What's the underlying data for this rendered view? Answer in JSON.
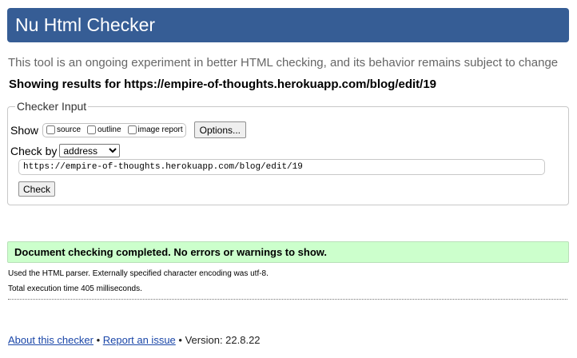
{
  "header": {
    "title": "Nu Html Checker"
  },
  "tagline": "This tool is an ongoing experiment in better HTML checking, and its behavior remains subject to change",
  "results_for": "Showing results for https://empire-of-thoughts.herokuapp.com/blog/edit/19",
  "checker_input": {
    "legend": "Checker Input",
    "show_label": "Show",
    "show_options": [
      {
        "label": "source",
        "checked": false
      },
      {
        "label": "outline",
        "checked": false
      },
      {
        "label": "image report",
        "checked": false
      }
    ],
    "options_button": "Options...",
    "check_by_label": "Check by",
    "check_by_selected": "address",
    "url_value": "https://empire-of-thoughts.herokuapp.com/blog/edit/19",
    "check_button": "Check"
  },
  "result": {
    "message": "Document checking completed. No errors or warnings to show.",
    "parser_info": "Used the HTML parser. Externally specified character encoding was utf-8.",
    "timing": "Total execution time 405 milliseconds."
  },
  "footer": {
    "about_link": "About this checker",
    "sep1": " • ",
    "report_link": "Report an issue",
    "sep2": " • ",
    "version": "Version: 22.8.22"
  },
  "colors": {
    "header_bg": "#365d95",
    "success_bg": "#ccffcc",
    "link": "#1a46a8"
  }
}
